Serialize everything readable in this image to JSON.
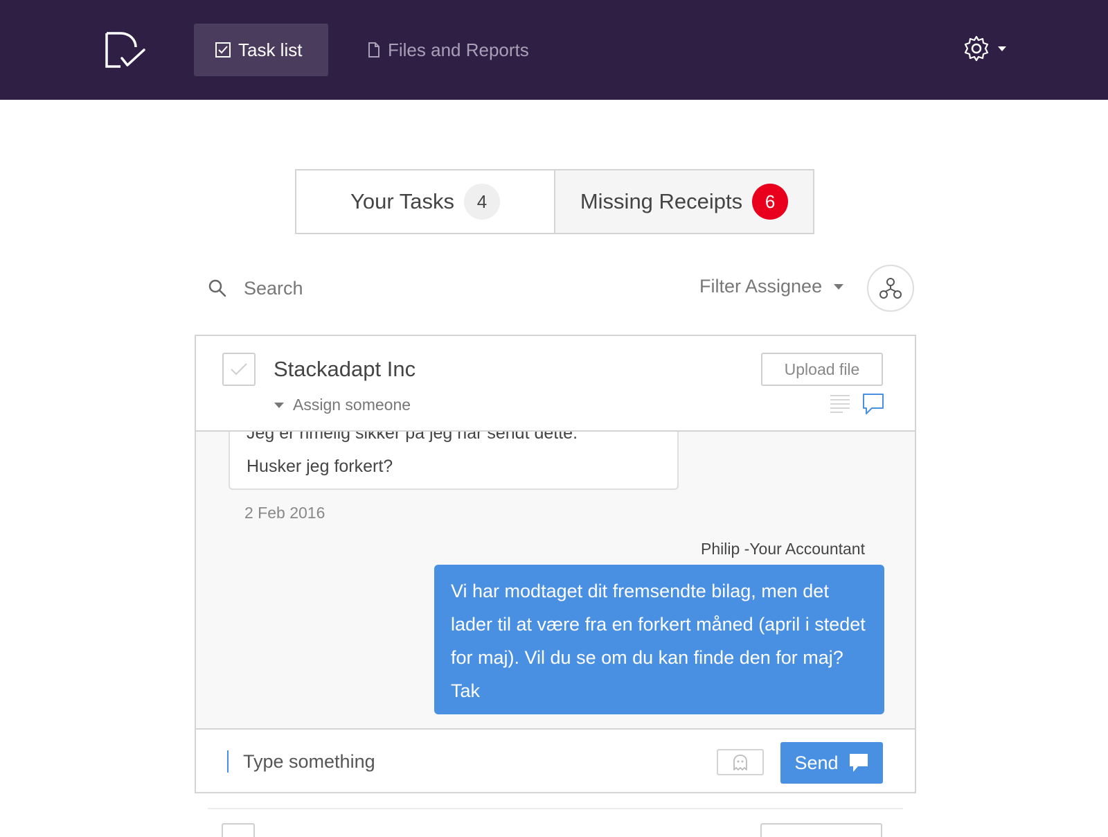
{
  "nav": {
    "tabs": [
      {
        "label": "Task list",
        "icon": "checkbox-icon",
        "active": true
      },
      {
        "label": "Files and Reports",
        "icon": "document-icon",
        "active": false
      }
    ],
    "settings_icon": "gear-icon"
  },
  "segments": [
    {
      "label": "Your Tasks",
      "count": "4"
    },
    {
      "label": "Missing Receipts",
      "count": "6"
    }
  ],
  "search": {
    "placeholder": "Search"
  },
  "filter": {
    "label": "Filter Assignee"
  },
  "task": {
    "company": "Stackadapt Inc",
    "assign_label": "Assign someone",
    "upload_label": "Upload file"
  },
  "thread": {
    "incoming_partial_line": "Jeg er rimelig sikker på jeg har sendt dette.",
    "incoming_line": "Husker jeg forkert?",
    "date": "2 Feb 2016",
    "sender": "Philip -Your Accountant",
    "outgoing": "Vi har modtaget dit fremsendte bilag, men det lader til at være fra en forkert måned (april i stedet for maj). Vil du se om du kan finde den for maj? Tak"
  },
  "composer": {
    "placeholder": "Type something",
    "send_label": "Send"
  },
  "colors": {
    "topbar": "#2f1f45",
    "accent_blue": "#4a90e2",
    "badge_red": "#e8001c"
  }
}
